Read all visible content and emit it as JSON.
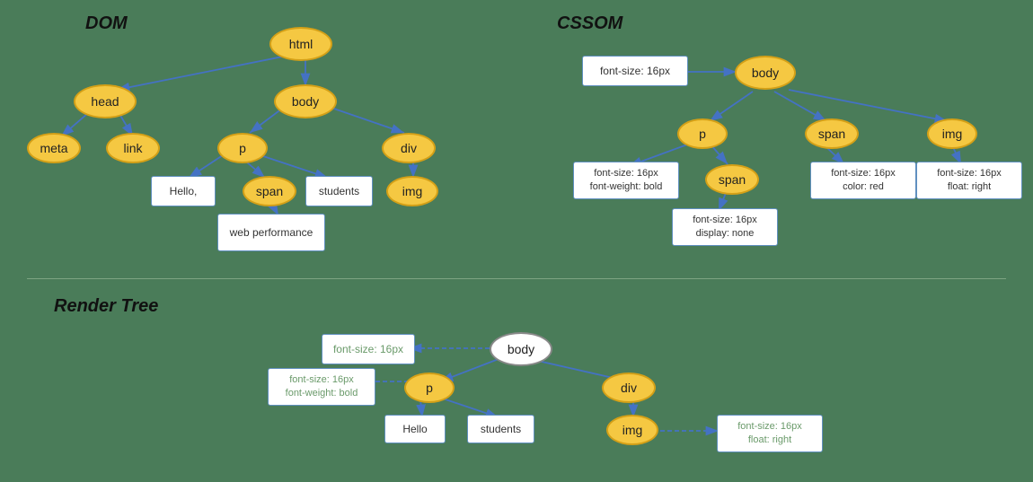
{
  "sections": {
    "dom_title": "DOM",
    "cssom_title": "CSSOM",
    "render_title": "Render Tree"
  },
  "dom_nodes": {
    "html": "html",
    "head": "head",
    "body": "body",
    "meta": "meta",
    "link": "link",
    "p": "p",
    "span_dom": "span",
    "div_dom": "div",
    "img_dom": "img",
    "hello": "Hello,",
    "students": "students",
    "web_performance": "web performance"
  },
  "cssom_nodes": {
    "body": "body",
    "p": "p",
    "span": "span",
    "img": "img",
    "span_child": "span",
    "fs16_body": "font-size: 16px",
    "fs16_bold": "font-size: 16px\nfont-weight: bold",
    "fs16_red": "font-size: 16px\ncolor: red",
    "fs16_float": "font-size: 16px\nfloat: right",
    "fs16_none": "font-size: 16px\ndisplay: none"
  },
  "render_nodes": {
    "body": "body",
    "p": "p",
    "div": "div",
    "img": "img",
    "hello": "Hello",
    "students": "students",
    "fs16": "font-size: 16px",
    "fs16_bold": "font-size: 16px\nfont-weight: bold",
    "fs16_float": "font-size: 16px\nfloat: right"
  }
}
